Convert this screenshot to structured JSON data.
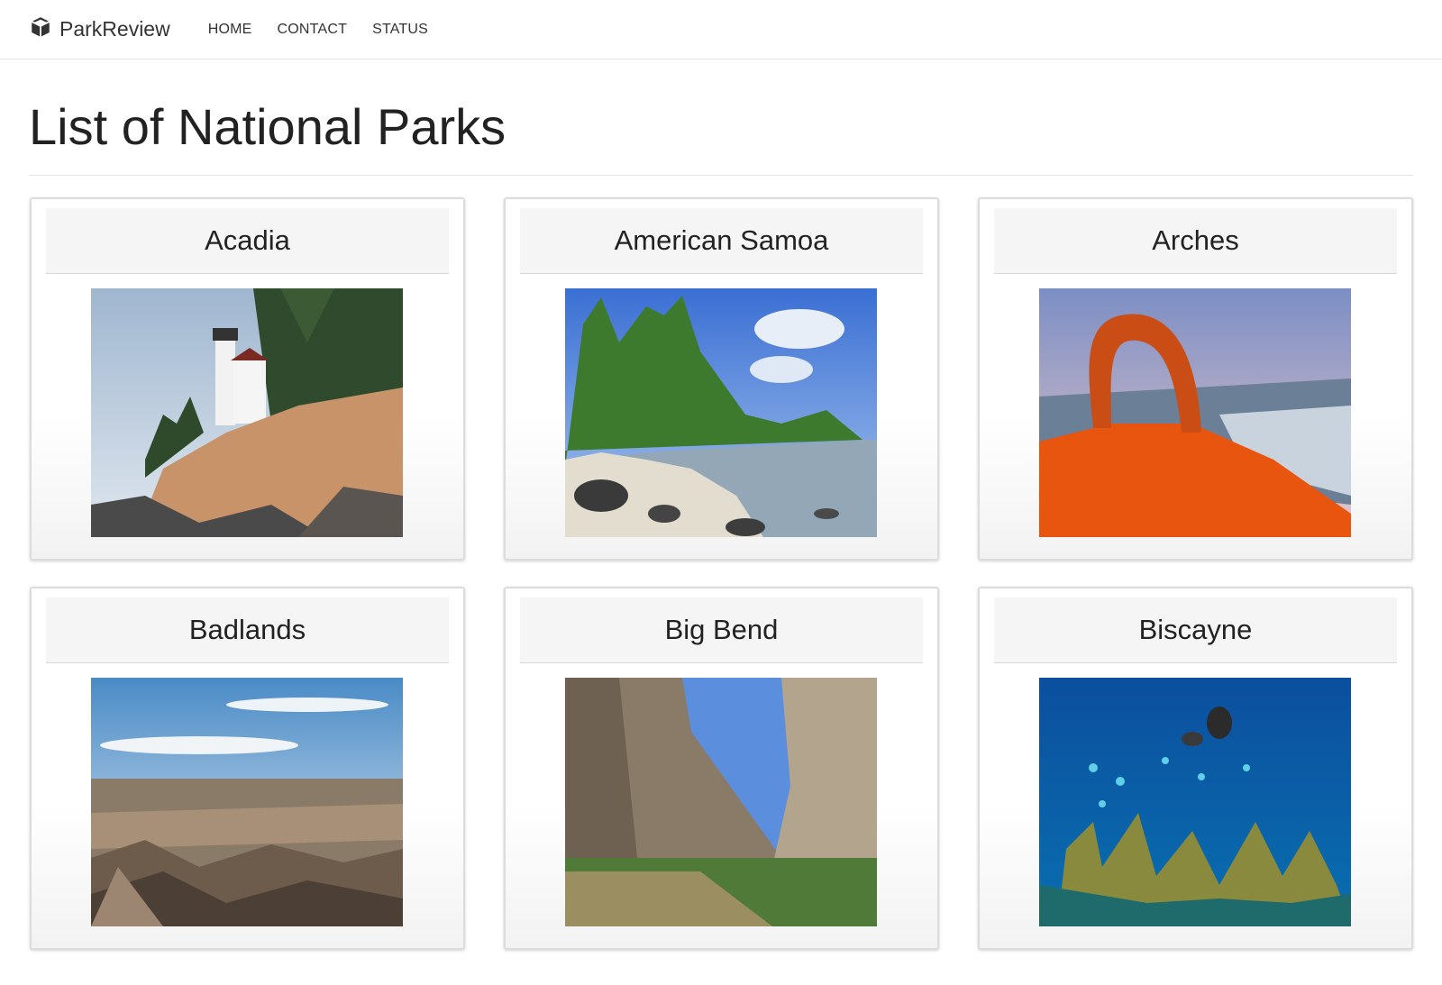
{
  "navbar": {
    "brand": "ParkReview",
    "links": [
      "HOME",
      "CONTACT",
      "STATUS"
    ]
  },
  "page": {
    "title": "List of National Parks"
  },
  "parks": [
    {
      "name": "Acadia"
    },
    {
      "name": "American Samoa"
    },
    {
      "name": "Arches"
    },
    {
      "name": "Badlands"
    },
    {
      "name": "Big Bend"
    },
    {
      "name": "Biscayne"
    }
  ],
  "icons": {
    "brand": "cube-icon"
  }
}
